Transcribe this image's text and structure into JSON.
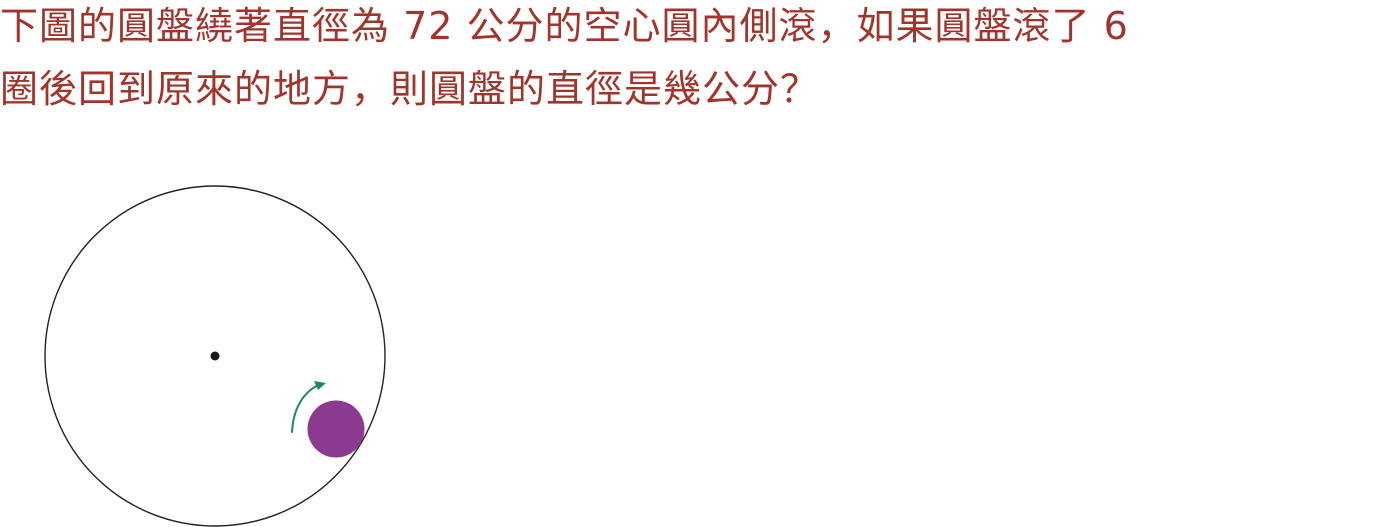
{
  "question": {
    "line1": "下圖的圓盤繞著直徑為 72 公分的空心圓內側滾，如果圓盤滾了 6",
    "line2": "圈後回到原來的地方，則圓盤的直徑是幾公分？"
  },
  "colors": {
    "question_text": "#a2342c",
    "large_circle_stroke": "#222222",
    "center_dot": "#1a1a1a",
    "disc_fill": "#8b3a8f",
    "arrow": "#1e8a5a"
  },
  "icons": {
    "rotation_arrow": "curved-arrow-icon"
  }
}
